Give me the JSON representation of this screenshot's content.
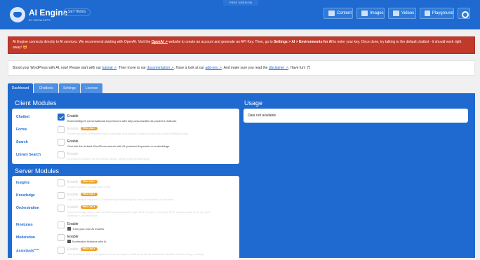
{
  "header": {
    "free_version": "FREE VERSION",
    "title": "AI Engine",
    "subtitle": "BY MEOW APPS",
    "settings_label": "SETTINGS",
    "nav": [
      {
        "label": "Content",
        "icon": "content-icon"
      },
      {
        "label": "Images",
        "icon": "images-icon"
      },
      {
        "label": "Videos",
        "icon": "videos-icon"
      },
      {
        "label": "Playground",
        "icon": "playground-icon"
      }
    ],
    "wrench_icon": "wrench-icon"
  },
  "alert": {
    "text_1": "AI Engine connects directly to AI services. We recommend starting with OpenAI. Visit the ",
    "link": "OpenAI ↗",
    "text_2": " website to create an account and generate an API Key. Then, go to ",
    "path": "Settings > AI > Environments for AI",
    "text_3": " to enter your key. Once done, try talking to the default chatbot - it should work right away! 😺"
  },
  "info": {
    "t1": "Boost your WordPress with AI, now! Please start with our ",
    "link_tutorial": "tutorial ↗",
    "t2": ". Then move to our ",
    "link_doc": "documentation ↗",
    "t3": ". Have a look at our ",
    "link_addons": "add-ons ↗",
    "t4": ". And make sure you read the ",
    "link_disclaimer": "disclaimer ↗",
    "t5": ". Have fun! 🎵"
  },
  "tabs": [
    "Dashboard",
    "Chatbots",
    "Settings",
    "License"
  ],
  "client_modules": {
    "title": "Client Modules",
    "rows": [
      {
        "label": "Chatbot",
        "option": "Enable",
        "desc": "Build intelligent conversational experiences with fully customizable AI-powered chatbots.",
        "checked": true,
        "pro": false,
        "disabled": false
      },
      {
        "label": "Forms",
        "option": "Enable",
        "desc": "Create dynamic, intelligent forms that adapt and respond based on user input with intelligent logic.",
        "checked": false,
        "pro": true,
        "disabled": true
      },
      {
        "label": "Search",
        "option": "Enable",
        "desc": "Override the default WordPress search with AI: powered keywords or embeddings.",
        "checked": false,
        "pro": false,
        "disabled": false
      },
      {
        "label": "Library Search",
        "option": "Enable",
        "desc": "AI-powered search for the Media Library using image embeddings.",
        "checked": false,
        "pro": false,
        "disabled": true
      }
    ]
  },
  "server_modules": {
    "title": "Server Modules",
    "rows": [
      {
        "label": "Insights",
        "option": "Enable",
        "desc": "Enable Queries, Usage and Limits.",
        "checked": false,
        "pro": true,
        "disabled": true
      },
      {
        "label": "Knowledge",
        "option": "Enable",
        "desc": "Add Contextual data for AI, Powered by embeddings for fast, personalized result time.",
        "checked": false,
        "pro": true,
        "disabled": true
      },
      {
        "label": "Orchestration",
        "option": "Enable",
        "desc": "Connect AI Agents to external tools and services through MCP servers. Currently, MCP servers need to be set up in",
        "desc2": "Settings > Orchestration.",
        "checked": false,
        "pro": true,
        "disabled": true
      },
      {
        "label": "Finetunes",
        "option": "Enable",
        "desc": "Train your own AI models.",
        "checked": false,
        "pro": false,
        "disabled": false
      },
      {
        "label": "Moderation",
        "option": "Enable",
        "desc": "Moderation features with AI.",
        "checked": false,
        "pro": false,
        "disabled": false
      },
      {
        "label": "Assistants",
        "label_sup": "BETA",
        "option": "Enable",
        "desc": "The Assistants API is designed to help developers build powerful AI assistants capable of performing a variety",
        "checked": false,
        "pro": true,
        "disabled": true
      }
    ]
  },
  "usage": {
    "title": "Usage",
    "value": "Data not available."
  },
  "pro_badge": "PRO ONLY"
}
